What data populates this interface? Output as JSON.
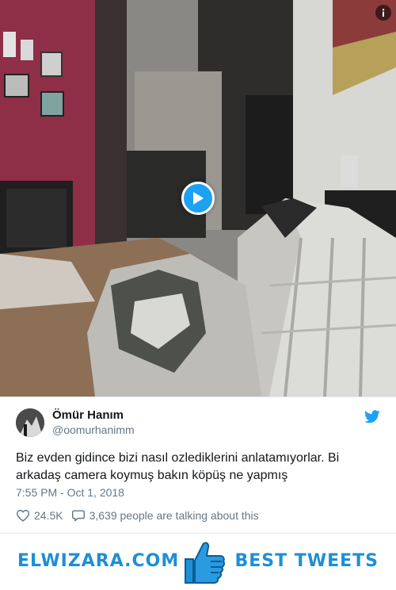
{
  "media": {
    "kind": "video",
    "icons": {
      "play": "play-icon",
      "info": "info-icon"
    }
  },
  "tweet": {
    "author_name": "Ömür Hanım",
    "author_handle": "@oomurhanimm",
    "text": "Biz evden gidince bizi nasıl ozlediklerini anlatamıyorlar. Bi arkadaş camera koymuş bakın köpüş ne yapmış",
    "timestamp": "7:55 PM - Oct 1, 2018",
    "likes": "24.5K",
    "talking": "3,639 people are talking about this",
    "icons": {
      "brand": "twitter-bird-icon",
      "like": "heart-icon",
      "reply": "speech-bubble-icon"
    }
  },
  "banner": {
    "left_text": "ELWIZARA.COM",
    "right_text": "BEST TWEETS",
    "icon": "thumbs-up-icon"
  },
  "colors": {
    "accent": "#1da1f2",
    "banner_text": "#1d8fd6",
    "secondary_text": "#657786"
  }
}
